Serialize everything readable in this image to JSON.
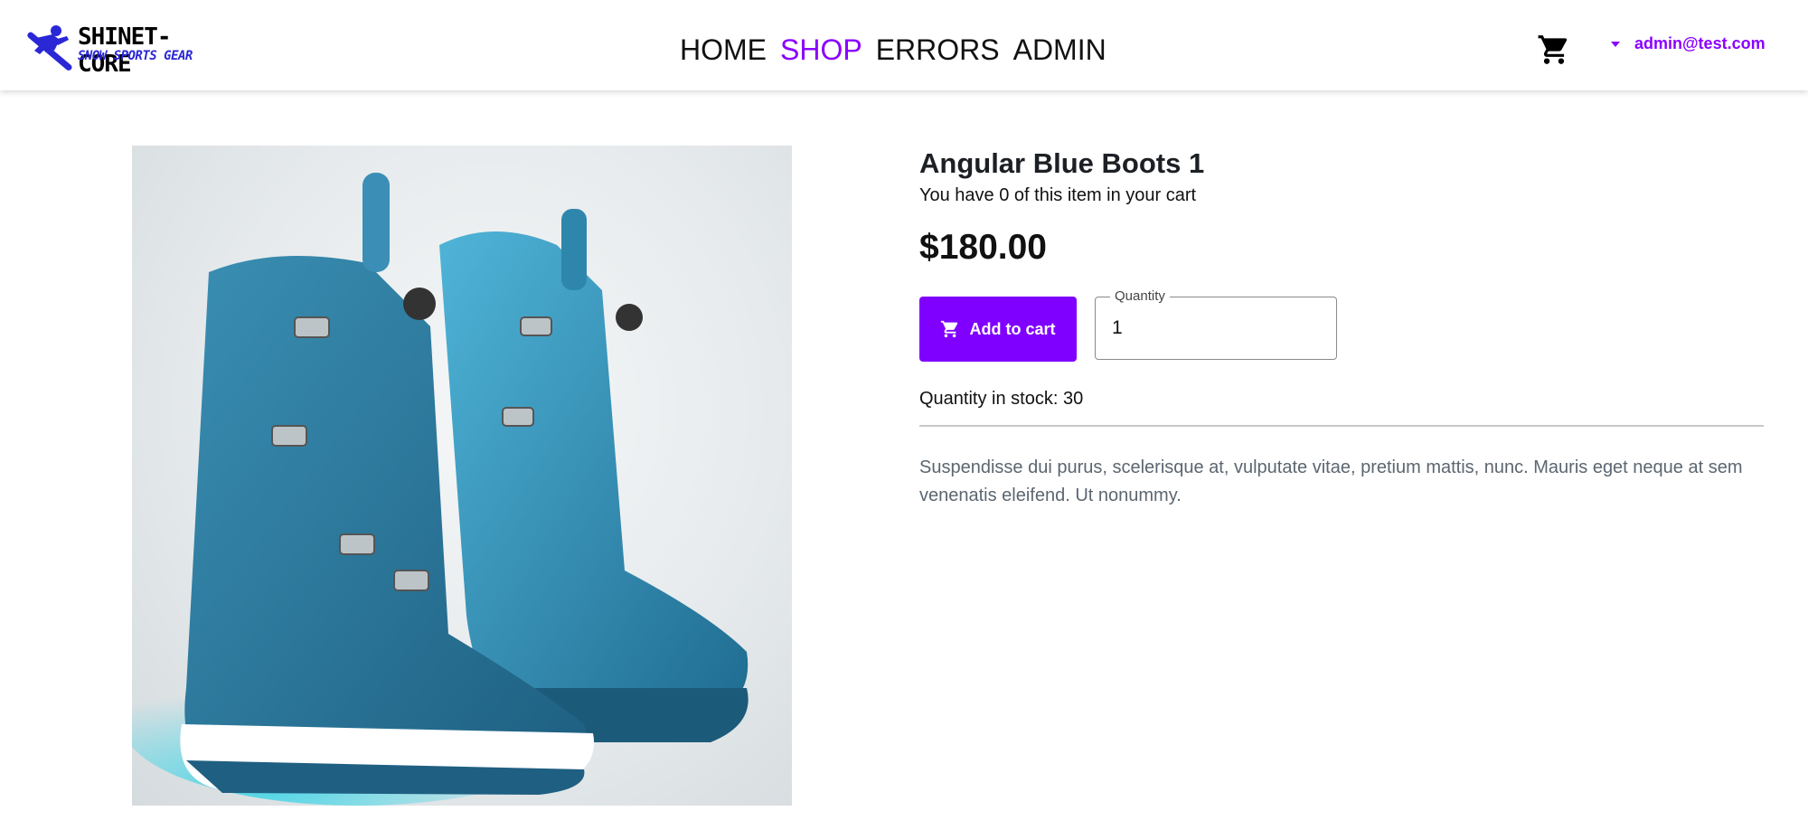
{
  "brand": {
    "name": "SHINET-CORE",
    "tagline": "SNOW SPORTS GEAR"
  },
  "nav": {
    "items": [
      {
        "label": "HOME",
        "active": false
      },
      {
        "label": "SHOP",
        "active": true
      },
      {
        "label": "ERRORS",
        "active": false
      },
      {
        "label": "ADMIN",
        "active": false
      }
    ],
    "cart_icon": "shopping-cart-icon",
    "user_email": "admin@test.com"
  },
  "colors": {
    "accent": "#8a00ff",
    "button": "#8000ff",
    "logo_blue": "#2a27d6"
  },
  "product": {
    "image_alt": "Angular Blue Boots 1",
    "title": "Angular Blue Boots 1",
    "cart_note": "You have 0 of this item in your cart",
    "price": "$180.00",
    "add_to_cart_label": "Add to cart",
    "quantity_label": "Quantity",
    "quantity_value": "1",
    "stock_text": "Quantity in stock: 30",
    "description": "Suspendisse dui purus, scelerisque at, vulputate vitae, pretium mattis, nunc. Mauris eget neque at sem venenatis eleifend. Ut nonummy."
  }
}
